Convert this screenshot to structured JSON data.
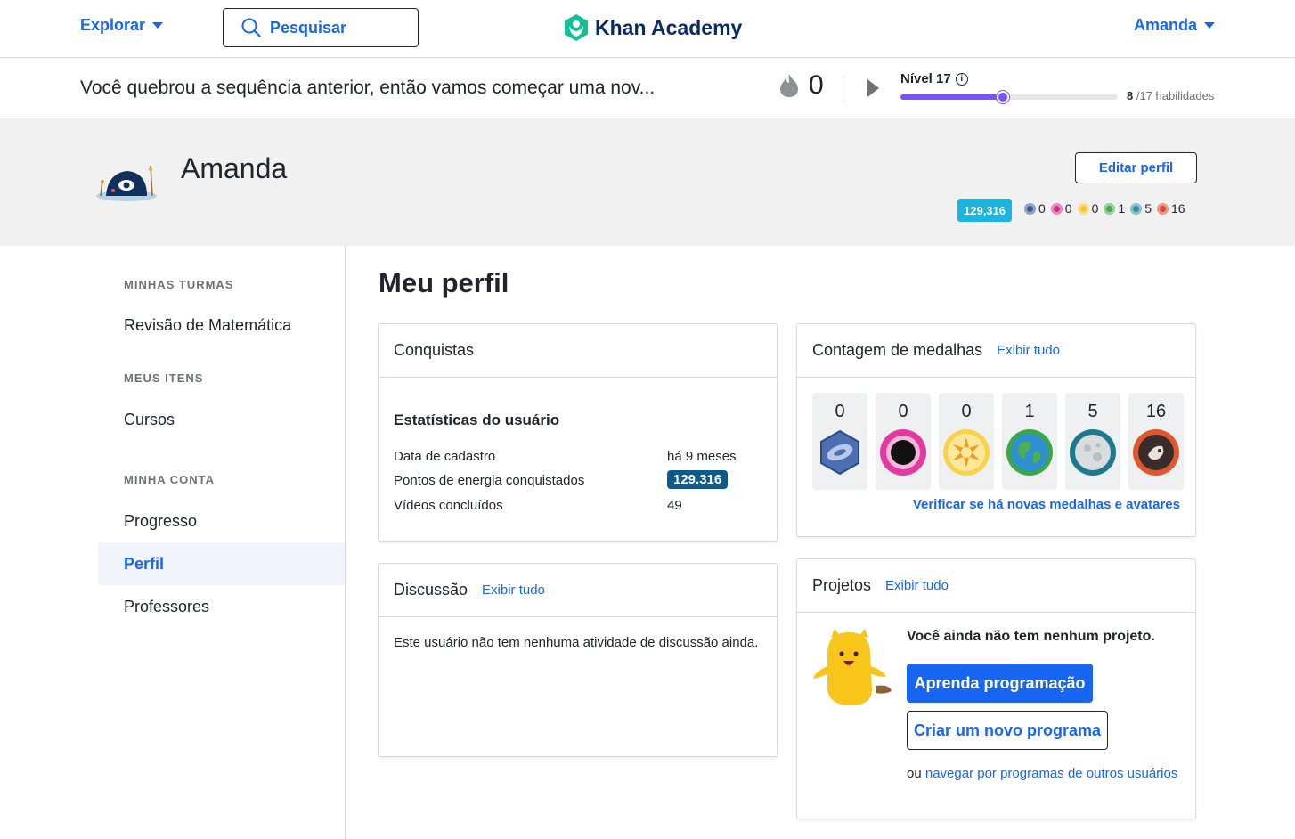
{
  "nav": {
    "explore_label": "Explorar",
    "search_placeholder": "Pesquisar",
    "logo_text": "Khan Academy",
    "user_label": "Amanda"
  },
  "streak": {
    "message": "Você quebrou a sequência anterior, então vamos começar uma nov...",
    "count": "0",
    "level_label": "Nível 17",
    "skills_done": "8",
    "skills_total": "/17 habilidades",
    "level_progress": 0.47
  },
  "profile": {
    "name": "Amanda",
    "edit_label": "Editar perfil",
    "points": "129,316",
    "mini_badges": [
      {
        "icon": "meteorite-badge-icon",
        "count": "0",
        "color": "#3b5a9a"
      },
      {
        "icon": "black-hole-badge-icon",
        "count": "0",
        "color": "#d22b8a"
      },
      {
        "icon": "sun-badge-icon",
        "count": "0",
        "color": "#f5c531"
      },
      {
        "icon": "earth-badge-icon",
        "count": "1",
        "color": "#3ea94e"
      },
      {
        "icon": "moon-badge-icon",
        "count": "5",
        "color": "#2f8ea3"
      },
      {
        "icon": "challenge-patch-icon",
        "count": "16",
        "color": "#d64a2b"
      }
    ]
  },
  "sidebar": {
    "sections": [
      {
        "heading": "MINHAS TURMAS",
        "items": [
          "Revisão de Matemática"
        ]
      },
      {
        "heading": "MEUS ITENS",
        "items": [
          "Cursos"
        ]
      },
      {
        "heading": "MINHA CONTA",
        "items": [
          "Progresso",
          "Perfil",
          "Professores"
        ]
      }
    ],
    "active": "Perfil"
  },
  "main": {
    "title": "Meu perfil",
    "achievements": {
      "title": "Conquistas",
      "stats_title": "Estatísticas do usuário",
      "rows": [
        {
          "label": "Data de cadastro",
          "value": "há 9 meses"
        },
        {
          "label": "Pontos de energia conquistados",
          "value": "129.316"
        },
        {
          "label": "Vídeos concluídos",
          "value": "49"
        }
      ]
    },
    "badges": {
      "title": "Contagem de medalhas",
      "view_all": "Exibir tudo",
      "counts": [
        "0",
        "0",
        "0",
        "1",
        "5",
        "16"
      ],
      "icons": [
        "meteorite-badge-icon",
        "black-hole-badge-icon",
        "sun-badge-icon",
        "earth-badge-icon",
        "moon-badge-icon",
        "challenge-patch-icon"
      ],
      "check_link": "Verificar se há novas medalhas e avatares"
    },
    "discussion": {
      "title": "Discussão",
      "view_all": "Exibir tudo",
      "empty": "Este usuário não tem nenhuma atividade de discussão ainda."
    },
    "projects": {
      "title": "Projetos",
      "view_all": "Exibir tudo",
      "empty": "Você ainda não tem nenhum projeto.",
      "learn_button": "Aprenda programação",
      "new_button": "Criar um novo programa",
      "browse_prefix": "ou",
      "browse_link": "navegar por programas de outros usuários"
    }
  },
  "colors": {
    "accent": "#1865f2",
    "level": "#7854f7",
    "points": "#1cb5e0",
    "energy": "#0e5a8a"
  }
}
